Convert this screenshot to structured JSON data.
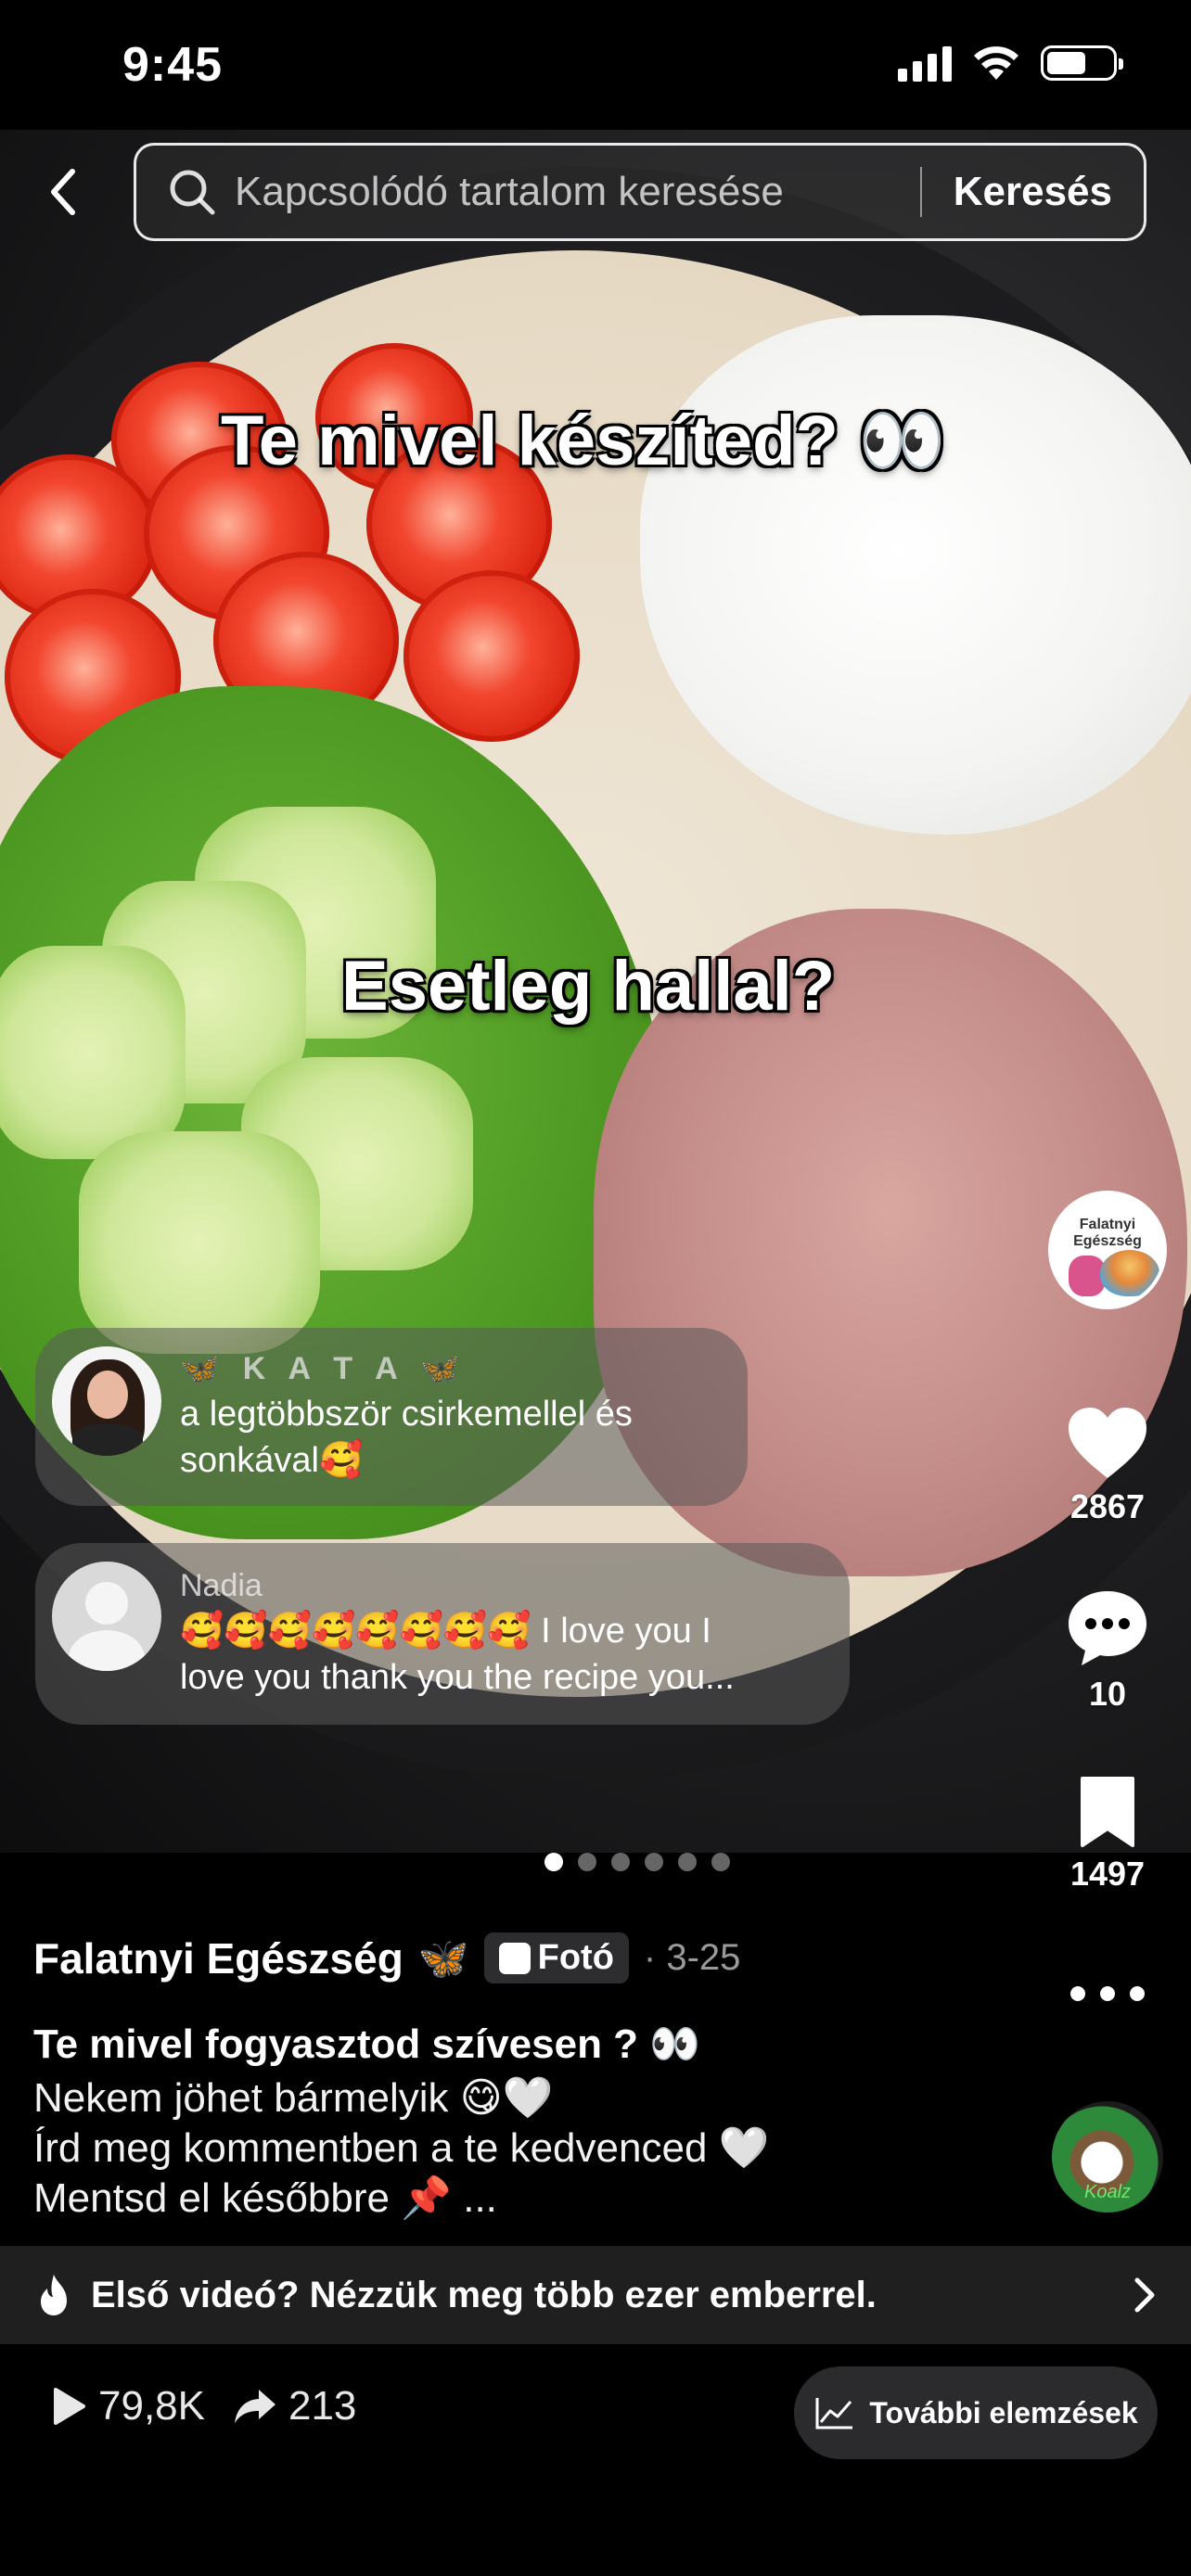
{
  "status_bar": {
    "time": "9:45",
    "battery_level": 0.6
  },
  "search": {
    "placeholder": "Kapcsolódó tartalom keresése",
    "submit_label": "Keresés",
    "back_icon": "chevron-left-icon",
    "search_icon": "search-icon"
  },
  "photo": {
    "caption_top": "Te mivel készíted? 👀",
    "caption_middle": "Esetleg hallal?",
    "page_count": 6,
    "active_page": 1
  },
  "profile": {
    "avatar_text": "Falatnyi Egészség"
  },
  "actions": {
    "likes": "2867",
    "comments": "10",
    "saves": "1497"
  },
  "comments": [
    {
      "author": "🦋 K A T A 🦋",
      "text_line1": "a legtöbbször csirkemellel és",
      "text_line2": "sonkával🥰"
    },
    {
      "author": "Nadia",
      "text_line1": "🥰🥰🥰🥰🥰🥰🥰🥰 I love you I",
      "text_line2": "love you thank you the recipe you..."
    }
  ],
  "post": {
    "author": "Falatnyi Egészség",
    "author_badge": "🦋",
    "type_label": "Fotó",
    "date": "· 3-25",
    "title": "Te mivel fogyasztod szívesen ? 👀",
    "desc_line1": "Nekem jöhet bármelyik 😋🤍",
    "desc_line2": "Írd meg kommentben a te kedvenced 🤍",
    "desc_line3": "Mentsd el későbbre 📌 ..."
  },
  "sound": {
    "label": "Koalz"
  },
  "promo": {
    "text": "Első videó? Nézzük meg több ezer emberrel."
  },
  "stats": {
    "views": "79,8K",
    "shares": "213",
    "analytics_label": "További elemzések"
  },
  "colors": {
    "accent_blue": "#2f8ef7",
    "promo_bg": "#1f1f1f",
    "pill_bg": "#2b2b2d"
  }
}
